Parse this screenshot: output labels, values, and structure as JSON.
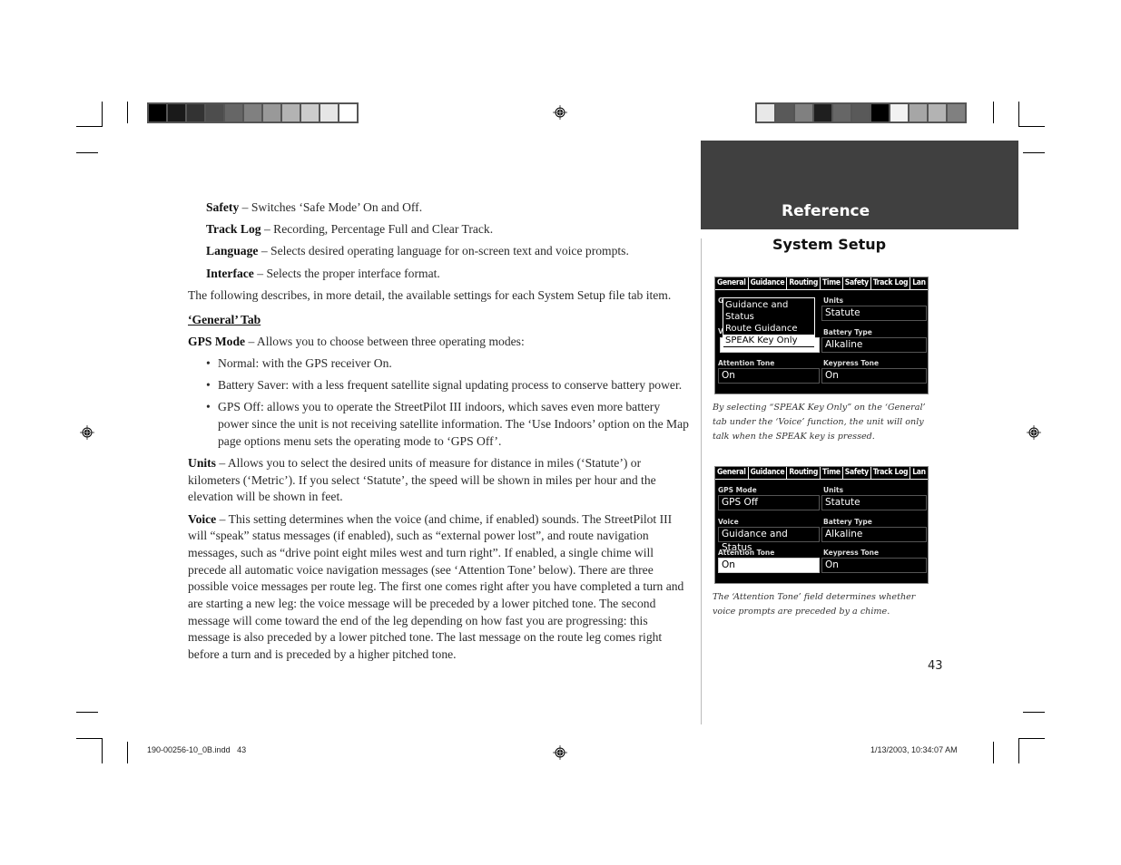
{
  "color_bars": {
    "left": [
      "#000000",
      "#1a1a1a",
      "#333333",
      "#4d4d4d",
      "#666666",
      "#808080",
      "#999999",
      "#b3b3b3",
      "#cccccc",
      "#e6e6e6",
      "#ffffff"
    ],
    "right": [
      "#e8e8e8",
      "#595959",
      "#808080",
      "#1f1f1f",
      "#666666",
      "#595959",
      "#000000",
      "#f2f2f2",
      "#a6a6a6",
      "#b3b3b3",
      "#808080"
    ]
  },
  "header": {
    "section": "Reference",
    "subsection": "System Setup"
  },
  "body": {
    "items": [
      {
        "term": "Safety",
        "desc": " – Switches ‘Safe Mode’ On and Off."
      },
      {
        "term": "Track Log",
        "desc": " – Recording, Percentage Full and Clear Track."
      },
      {
        "term": "Language",
        "desc": " – Selects desired operating language for on-screen text and voice prompts."
      },
      {
        "term": "Interface",
        "desc": " – Selects the proper interface format."
      }
    ],
    "intro": "The following describes, in more detail, the available settings for each System Setup file tab item.",
    "tab_heading": "‘General’ Tab",
    "gps_mode": {
      "term": "GPS Mode",
      "desc": " – Allows you to choose between three operating modes:",
      "bullets": [
        "Normal: with the GPS receiver On.",
        "Battery Saver: with a less frequent satellite signal updating process to conserve battery power.",
        "GPS Off: allows you to operate the StreetPilot III indoors, which saves even more battery power since the unit is not receiving satellite information.  The ‘Use Indoors’ option on the Map page options menu sets the operating mode to ‘GPS Off’."
      ]
    },
    "units": {
      "term": "Units",
      "desc": " – Allows you to select the desired units of measure for distance in miles (‘Statute’) or kilometers (‘Metric’). If you select ‘Statute’, the speed will be shown in miles per hour and the elevation will be shown in feet."
    },
    "voice": {
      "term": "Voice",
      "desc": " – This setting determines when the voice (and chime, if enabled) sounds.  The StreetPilot III will “speak” status messages (if enabled), such as “external power lost”, and route navigation messages, such as “drive point eight miles west and turn right”.  If enabled, a single chime will precede all automatic voice navigation messages (see ‘Attention Tone’ below).  There are three possible voice messages per route leg.  The first one comes right after you have completed a turn and are starting a new leg: the voice message will be preceded by a lower pitched tone.  The second message will come toward the end of the leg depending on how fast you are progressing: this message is also preceded by a lower pitched tone.  The last message on the route leg comes right before a turn and is preceded by a higher pitched tone."
    }
  },
  "screen1": {
    "tabs": [
      "General",
      "Guidance",
      "Routing",
      "Time",
      "Safety",
      "Track Log",
      "Lan"
    ],
    "popup_options": [
      "Guidance and Status",
      "Route Guidance",
      "SPEAK Key Only"
    ],
    "popup_selected": "SPEAK Key Only",
    "left_hidden_label_1": "G",
    "left_hidden_label_2": "V",
    "voice_value": "Guidance and Status",
    "units_label": "Units",
    "units_value": "Statute",
    "battery_label": "Battery Type",
    "battery_value": "Alkaline",
    "attention_label": "Attention Tone",
    "attention_value": "On",
    "keypress_label": "Keypress Tone",
    "keypress_value": "On"
  },
  "caption1": "By selecting “SPEAK Key Only” on the ‘General’ tab under the ‘Voice’ function, the unit will only talk when the SPEAK key is pressed.",
  "screen2": {
    "tabs": [
      "General",
      "Guidance",
      "Routing",
      "Time",
      "Safety",
      "Track Log",
      "Lan"
    ],
    "gps_label": "GPS Mode",
    "gps_value": "GPS Off",
    "units_label": "Units",
    "units_value": "Statute",
    "voice_label": "Voice",
    "voice_value": "Guidance and Status",
    "battery_label": "Battery Type",
    "battery_value": "Alkaline",
    "attention_label": "Attention Tone",
    "attention_value": "On",
    "keypress_label": "Keypress Tone",
    "keypress_value": "On"
  },
  "caption2": "The ‘Attention Tone’ field determines whether voice prompts are preceded by a chime.",
  "page_number": "43",
  "slug": {
    "file": "190-00256-10_0B.indd   43",
    "timestamp": "1/13/2003, 10:34:07 AM"
  }
}
